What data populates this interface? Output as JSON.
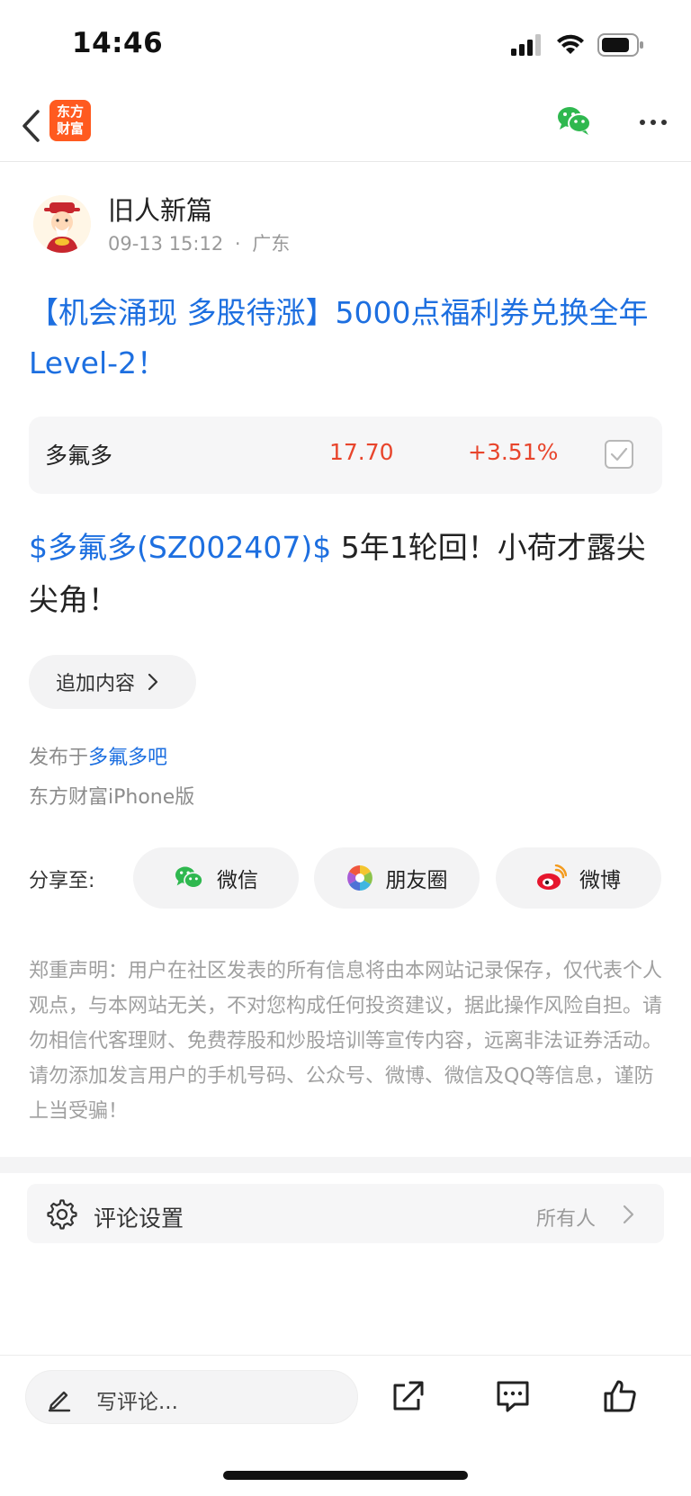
{
  "status_bar": {
    "time": "14:46"
  },
  "nav": {
    "logo_line1": "东方",
    "logo_line2": "财富"
  },
  "author": {
    "name": "旧人新篇",
    "time": "09-13 15:12",
    "separator": "·",
    "location": "广东"
  },
  "post": {
    "title": "【机会涌现 多股待涨】5000点福利券兑换全年Level-2！",
    "stock_link": "$多氟多(SZ002407)$",
    "body_text": " 5年1轮回！小荷才露尖尖角！"
  },
  "stock_card": {
    "name": "多氟多",
    "price": "17.70",
    "change": "+3.51%",
    "colors": {
      "up": "#e8452c"
    }
  },
  "append_button": {
    "label": "追加内容"
  },
  "published": {
    "prefix": "发布于",
    "bar_name": "多氟多吧",
    "client": "东方财富iPhone版"
  },
  "share": {
    "label": "分享至:",
    "buttons": [
      {
        "label": "微信",
        "icon": "wechat-icon"
      },
      {
        "label": "朋友圈",
        "icon": "moments-icon"
      },
      {
        "label": "微博",
        "icon": "weibo-icon"
      }
    ]
  },
  "disclaimer": "郑重声明：用户在社区发表的所有信息将由本网站记录保存，仅代表个人观点，与本网站无关，不对您构成任何投资建议，据此操作风险自担。请勿相信代客理财、免费荐股和炒股培训等宣传内容，远离非法证券活动。请勿添加发言用户的手机号码、公众号、微博、微信及QQ等信息，谨防上当受骗！",
  "comment_settings": {
    "label": "评论设置",
    "value": "所有人"
  },
  "bottom_bar": {
    "placeholder": "写评论..."
  },
  "colors": {
    "link_blue": "#1d6fe0",
    "brand_orange": "#ff5a1f",
    "wechat_green": "#2fb84f"
  }
}
